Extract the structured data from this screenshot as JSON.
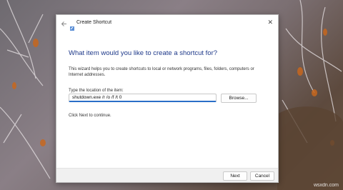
{
  "window": {
    "title": "Create Shortcut",
    "back_icon": "back-arrow-icon",
    "wizard_icon": "shortcut-wizard-icon",
    "close_label": "✕"
  },
  "content": {
    "heading": "What item would you like to create a shortcut for?",
    "description": "This wizard helps you to create shortcuts to local or network programs, files, folders, computers or Internet addresses.",
    "location_label": "Type the location of the item:",
    "location_value": "shutdown.exe /r /o /f /t 0",
    "browse_label": "Browse...",
    "hint": "Click Next to continue."
  },
  "footer": {
    "next_label": "Next",
    "cancel_label": "Cancel"
  },
  "watermark": "wsxdn.com",
  "colors": {
    "heading": "#1f3a8a",
    "input_focus": "#2a6ec8"
  }
}
